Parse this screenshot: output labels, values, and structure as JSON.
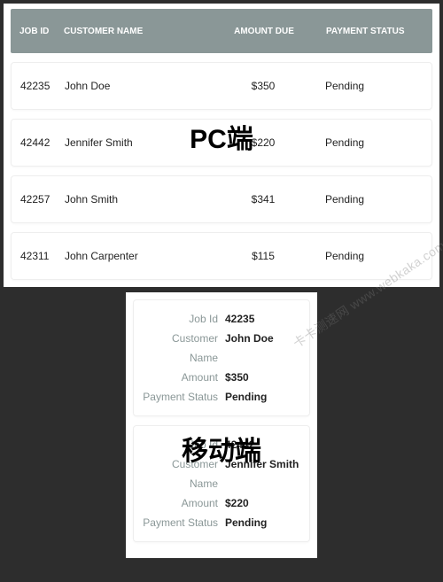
{
  "overlay": {
    "pc_label": "PC端",
    "mobile_label": "移动端",
    "watermark": "卡卡测速网 www.webkaka.com"
  },
  "headers": {
    "job_id": "JOB ID",
    "customer_name": "CUSTOMER NAME",
    "amount_due": "AMOUNT DUE",
    "payment_status": "PAYMENT STATUS"
  },
  "mobile_labels": {
    "job_id": "Job Id",
    "customer_name": "Customer Name",
    "amount": "Amount",
    "payment_status": "Payment Status"
  },
  "rows": [
    {
      "id": "42235",
      "name": "John Doe",
      "amount": "$350",
      "status": "Pending"
    },
    {
      "id": "42442",
      "name": "Jennifer Smith",
      "amount": "$220",
      "status": "Pending"
    },
    {
      "id": "42257",
      "name": "John Smith",
      "amount": "$341",
      "status": "Pending"
    },
    {
      "id": "42311",
      "name": "John Carpenter",
      "amount": "$115",
      "status": "Pending"
    }
  ]
}
